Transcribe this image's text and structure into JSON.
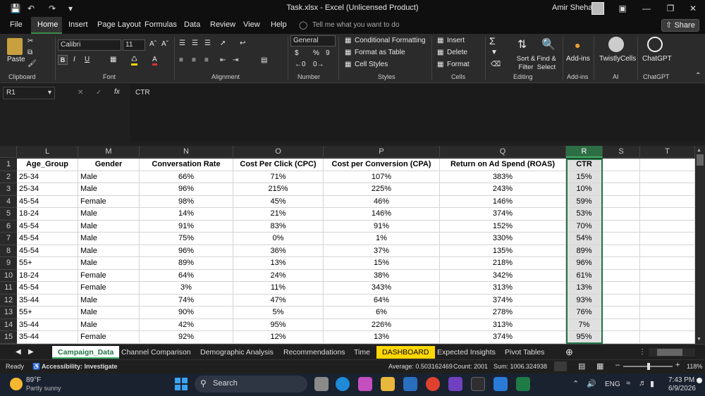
{
  "window": {
    "title": "Task.xlsx  -  Excel (Unlicensed Product)",
    "user": "Amir Shehata"
  },
  "menu": [
    "File",
    "Home",
    "Insert",
    "Page Layout",
    "Formulas",
    "Data",
    "Review",
    "View",
    "Help"
  ],
  "tell_me": "Tell me what you want to do",
  "share_label": "Share",
  "ribbon": {
    "paste": "Paste",
    "font_name": "Calibri",
    "font_size": "11",
    "number_format": "General",
    "cond_format": "Conditional Formatting",
    "format_table": "Format as Table",
    "cell_styles": "Cell Styles",
    "insert": "Insert",
    "delete": "Delete",
    "format": "Format",
    "sort_filter": "Sort & Filter",
    "find_select": "Find & Select",
    "addins": "Add-ins",
    "twistly": "TwistlyCells",
    "chatgpt": "ChatGPT",
    "groups": [
      "Clipboard",
      "Font",
      "Alignment",
      "Number",
      "Styles",
      "Cells",
      "Editing",
      "Add-ins",
      "AI",
      "ChatGPT"
    ]
  },
  "formula": {
    "name_box": "R1",
    "value": "CTR"
  },
  "columns": [
    "L",
    "M",
    "N",
    "O",
    "P",
    "Q",
    "R",
    "S",
    "T"
  ],
  "headers": [
    "Age_Group",
    "Gender",
    "Conversation Rate",
    "Cost Per Click (CPC)",
    "Cost per Conversion (CPA)",
    "Return on Ad Spend (ROAS)",
    "CTR"
  ],
  "rows": [
    [
      "25-34",
      "Male",
      "66%",
      "71%",
      "107%",
      "383%",
      "15%"
    ],
    [
      "25-34",
      "Male",
      "96%",
      "215%",
      "225%",
      "243%",
      "10%"
    ],
    [
      "45-54",
      "Female",
      "98%",
      "45%",
      "46%",
      "146%",
      "59%"
    ],
    [
      "18-24",
      "Male",
      "14%",
      "21%",
      "146%",
      "374%",
      "53%"
    ],
    [
      "45-54",
      "Male",
      "91%",
      "83%",
      "91%",
      "152%",
      "70%"
    ],
    [
      "45-54",
      "Male",
      "75%",
      "0%",
      "1%",
      "330%",
      "54%"
    ],
    [
      "45-54",
      "Male",
      "96%",
      "36%",
      "37%",
      "135%",
      "89%"
    ],
    [
      "55+",
      "Male",
      "89%",
      "13%",
      "15%",
      "218%",
      "96%"
    ],
    [
      "18-24",
      "Female",
      "64%",
      "24%",
      "38%",
      "342%",
      "61%"
    ],
    [
      "45-54",
      "Female",
      "3%",
      "11%",
      "343%",
      "313%",
      "13%"
    ],
    [
      "35-44",
      "Male",
      "74%",
      "47%",
      "64%",
      "374%",
      "93%"
    ],
    [
      "55+",
      "Male",
      "90%",
      "5%",
      "6%",
      "278%",
      "76%"
    ],
    [
      "35-44",
      "Male",
      "42%",
      "95%",
      "226%",
      "313%",
      "7%"
    ],
    [
      "35-44",
      "Female",
      "92%",
      "12%",
      "13%",
      "374%",
      "95%"
    ]
  ],
  "row_numbers": [
    "1",
    "2",
    "3",
    "4",
    "5",
    "6",
    "7",
    "8",
    "9",
    "10",
    "11",
    "12",
    "13",
    "14",
    "15"
  ],
  "sheets": [
    "Campaign_Data",
    "Channel Comparison",
    "Demographic Analysis",
    "Recommendations",
    "Time",
    "DASHBOARD",
    "Expected Insights",
    "Pivot Tables"
  ],
  "status": {
    "ready": "Ready",
    "accessibility": "Accessibility: Investigate",
    "average": "Average: 0.503162469",
    "count": "Count: 2001",
    "sum": "Sum: 1006.324938",
    "zoom": "118%"
  },
  "taskbar": {
    "temp": "89°F",
    "weather": "Partly sunny",
    "search": "Search",
    "lang": "ENG",
    "time": "7:43 PM",
    "date": "6/9/2026"
  }
}
